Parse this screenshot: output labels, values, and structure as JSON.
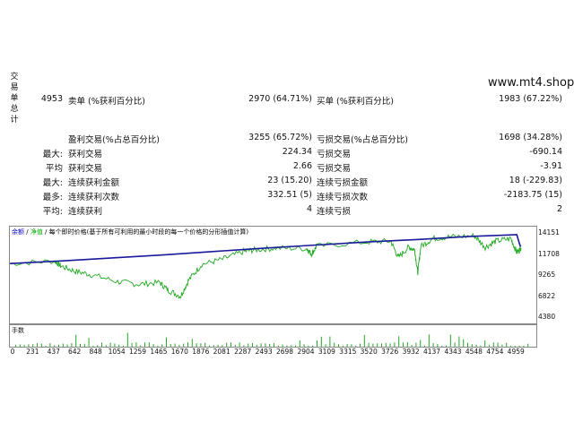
{
  "side_label": [
    "交",
    "易",
    "单",
    "总",
    "计"
  ],
  "site": "www.mt4.shop",
  "stats": {
    "total_trades": "4953",
    "sell_label": "卖单 (%获利百分比)",
    "sell_value": "2970 (64.71%)",
    "buy_label": "买单 (%获利百分比)",
    "buy_value": "1983 (67.22%)",
    "profit_trades_label": "盈利交易(%占总百分比)",
    "profit_trades_value": "3255 (65.72%)",
    "loss_trades_label": "亏损交易(%占总百分比)",
    "loss_trades_value": "1698 (34.28%)",
    "largest_label": "最大:",
    "largest_profit_label": "获利交易",
    "largest_profit_value": "224.34",
    "largest_loss_label": "亏损交易",
    "largest_loss_value": "-690.14",
    "average_label": "平均",
    "average_profit_label": "获利交易",
    "average_profit_value": "2.66",
    "average_loss_label": "亏损交易",
    "average_loss_value": "-3.91",
    "max_consec_label": "最大:",
    "max_consec_wins_label": "连续获利金额",
    "max_consec_wins_value": "23 (15.20)",
    "max_consec_losses_label": "连续亏损金额",
    "max_consec_losses_value": "18 (-229.83)",
    "most_label": "最多:",
    "most_consec_profit_label": "连续获利次数",
    "most_consec_profit_value": "332.51 (5)",
    "most_consec_loss_label": "连续亏损次数",
    "most_consec_loss_value": "-2183.75 (15)",
    "avg_consec_label": "平均:",
    "avg_consec_wins_label": "连续获利",
    "avg_consec_wins_value": "4",
    "avg_consec_losses_label": "连续亏损",
    "avg_consec_losses_value": "2"
  },
  "chart_data": {
    "type": "line",
    "legend_text": {
      "balance": "余额",
      "sep1": " / ",
      "equity": "净值",
      "sep2": " / ",
      "note": "每个即时价格(基于所有可利用的最小时段的每一个价格的分形插值计算)"
    },
    "y_ticks": [
      "14151",
      "11708",
      "9265",
      "6822",
      "4380"
    ],
    "ylim": [
      4380,
      14151
    ],
    "x_ticks": [
      "0",
      "231",
      "437",
      "642",
      "848",
      "1054",
      "1259",
      "1465",
      "1670",
      "1876",
      "2081",
      "2287",
      "2493",
      "2698",
      "2904",
      "3109",
      "3315",
      "3520",
      "3726",
      "3932",
      "4137",
      "4343",
      "4548",
      "4754",
      "4959"
    ],
    "xlim": [
      0,
      5150
    ],
    "volume_label": "手数",
    "series": [
      {
        "name": "余额",
        "color": "#1a1a9a",
        "x": [
          0,
          500,
          1000,
          1500,
          2000,
          2500,
          3000,
          3500,
          4000,
          4500,
          4959,
          4990,
          5000
        ],
        "values": [
          10700,
          11000,
          11350,
          11700,
          12100,
          12500,
          12850,
          13200,
          13500,
          13850,
          14050,
          12800,
          12700
        ]
      },
      {
        "name": "净值",
        "color": "#22aa22",
        "x": [
          0,
          437,
          500,
          642,
          800,
          1054,
          1259,
          1465,
          1550,
          1670,
          1750,
          1876,
          2081,
          2287,
          2400,
          2600,
          2904,
          2950,
          3000,
          3500,
          3726,
          3800,
          3900,
          3960,
          3990,
          4020,
          4137,
          4300,
          4548,
          4650,
          4754,
          4900,
          4959,
          5000
        ],
        "values": [
          10700,
          11000,
          10400,
          9800,
          9400,
          8600,
          8300,
          8500,
          7600,
          6900,
          8800,
          10600,
          11200,
          12100,
          12300,
          12500,
          12450,
          11800,
          12700,
          13200,
          13300,
          11400,
          12600,
          12300,
          9600,
          12700,
          13600,
          13800,
          13900,
          12600,
          13300,
          13600,
          12000,
          12500
        ]
      }
    ]
  }
}
